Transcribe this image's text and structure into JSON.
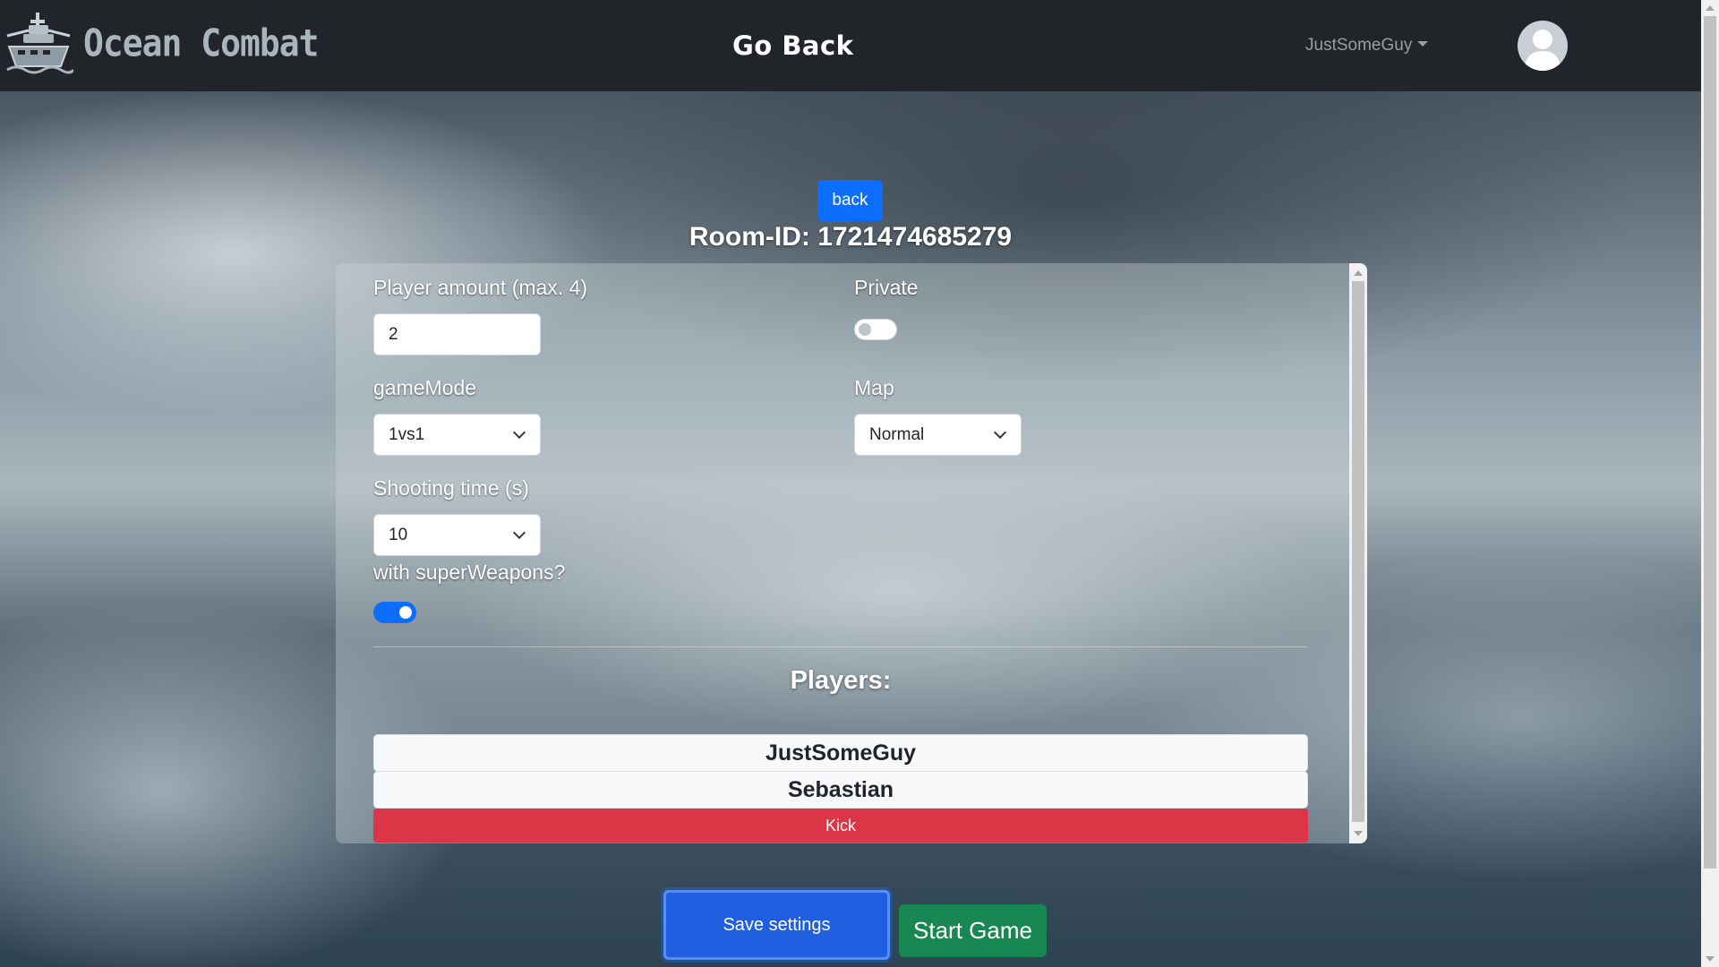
{
  "navbar": {
    "brand": "Ocean Combat",
    "go_back": "Go Back",
    "username": "JustSomeGuy"
  },
  "room": {
    "back_label": "back",
    "room_id_text": "Room-ID: 1721474685279"
  },
  "settings": {
    "player_amount_label": "Player amount (max. 4)",
    "player_amount_value": "2",
    "private_label": "Private",
    "private_enabled": false,
    "game_mode_label": "gameMode",
    "game_mode_value": "1vs1",
    "map_label": "Map",
    "map_value": "Normal",
    "shooting_time_label": "Shooting time (s)",
    "shooting_time_value": "10",
    "super_weapons_label": "with superWeapons?",
    "super_weapons_enabled": true
  },
  "players": {
    "title": "Players:",
    "list": [
      "JustSomeGuy",
      "Sebastian"
    ],
    "kick_label": "Kick"
  },
  "actions": {
    "save_label": "Save settings",
    "start_label": "Start Game"
  },
  "colors": {
    "navbar": "#212529",
    "primary": "#0d6efd",
    "danger": "#dc3545",
    "success": "#198754"
  }
}
